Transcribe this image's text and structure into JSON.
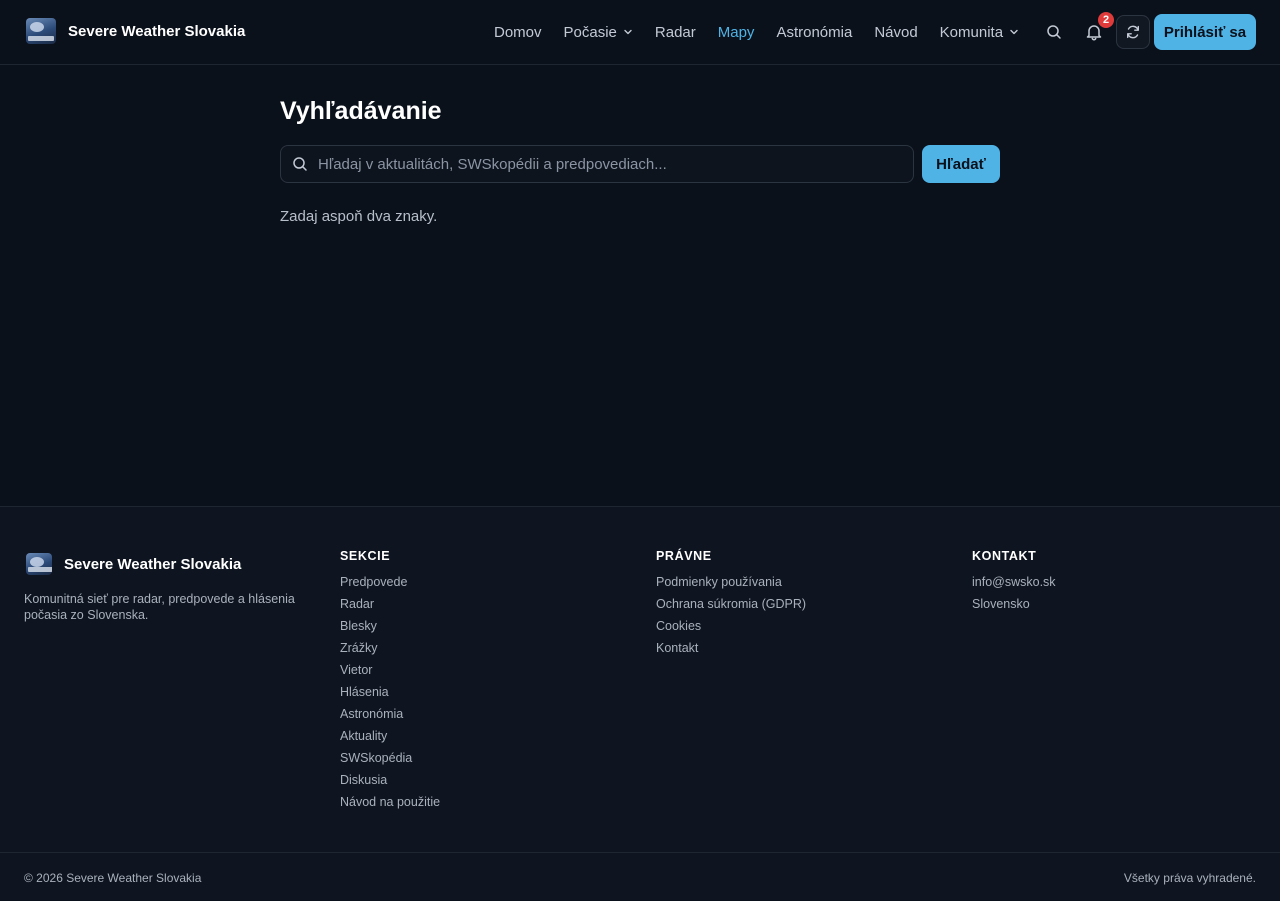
{
  "header": {
    "brand_name": "Severe Weather Slovakia",
    "logo_icon": "site-logo",
    "nav": [
      {
        "label": "Domov",
        "dropdown": false,
        "active": false
      },
      {
        "label": "Počasie",
        "dropdown": true,
        "active": false
      },
      {
        "label": "Radar",
        "dropdown": false,
        "active": false
      },
      {
        "label": "Mapy",
        "dropdown": false,
        "active": true
      },
      {
        "label": "Astronómia",
        "dropdown": false,
        "active": false
      },
      {
        "label": "Návod",
        "dropdown": false,
        "active": false
      },
      {
        "label": "Komunita",
        "dropdown": true,
        "active": false
      }
    ],
    "notification_count": "2",
    "login_label": "Prihlásiť sa",
    "icons": [
      "search-icon",
      "bell-icon",
      "refresh-icon",
      "chevron-down-icon"
    ]
  },
  "main": {
    "title": "Vyhľadávanie",
    "search_placeholder": "Hľadaj v aktualitách, SWSkopédii a predpovediach...",
    "search_value": "",
    "search_button": "Hľadať",
    "hint": "Zadaj aspoň dva znaky."
  },
  "footer": {
    "brand_name": "Severe Weather Slovakia",
    "description": "Komunitná sieť pre radar, predpovede a hlásenia počasia zo Slovenska.",
    "sections": {
      "title": "SEKCIE",
      "items": [
        "Predpovede",
        "Radar",
        "Blesky",
        "Zrážky",
        "Vietor",
        "Hlásenia",
        "Astronómia",
        "Aktuality",
        "SWSkopédia",
        "Diskusia",
        "Návod na použitie"
      ]
    },
    "legal": {
      "title": "PRÁVNE",
      "items": [
        "Podmienky používania",
        "Ochrana súkromia (GDPR)",
        "Cookies",
        "Kontakt"
      ]
    },
    "contact": {
      "title": "KONTAKT",
      "items": [
        "info@swsko.sk",
        "Slovensko"
      ]
    },
    "copyright": "© 2026 Severe Weather Slovakia",
    "rights": "Všetky práva vyhradené."
  },
  "colors": {
    "background": "#0b111b",
    "footer_background": "#0e1520",
    "accent": "#4fb3e6",
    "badge": "#e03b3b"
  }
}
